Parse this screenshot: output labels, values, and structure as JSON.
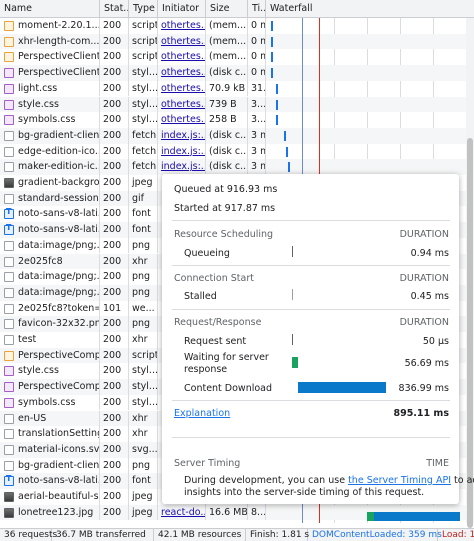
{
  "columns": [
    {
      "label": "Name"
    },
    {
      "label": "Stat..."
    },
    {
      "label": "Type"
    },
    {
      "label": "Initiator"
    },
    {
      "label": "Size"
    },
    {
      "label": "Ti..."
    },
    {
      "label": "Waterfall"
    }
  ],
  "rows": [
    {
      "name": "moment-2.20.1....",
      "status": "200",
      "type": "script",
      "initiator": "othertes...",
      "size": "(mem...",
      "time": "0 ms",
      "icon": "script"
    },
    {
      "name": "xhr-length-com...",
      "status": "200",
      "type": "script",
      "initiator": "othertes...",
      "size": "(mem...",
      "time": "0 ms",
      "icon": "script"
    },
    {
      "name": "PerspectiveClient...",
      "status": "200",
      "type": "script",
      "initiator": "othertes...",
      "size": "(mem...",
      "time": "0 ms",
      "icon": "script"
    },
    {
      "name": "PerspectiveClient...",
      "status": "200",
      "type": "styl...",
      "initiator": "othertes...",
      "size": "(disk c...",
      "time": "0 ms",
      "icon": "style"
    },
    {
      "name": "light.css",
      "status": "200",
      "type": "styl...",
      "initiator": "othertes...",
      "size": "70.9 kB",
      "time": "31...",
      "icon": "style"
    },
    {
      "name": "style.css",
      "status": "200",
      "type": "styl...",
      "initiator": "othertes...",
      "size": "739 B",
      "time": "3...",
      "icon": "style"
    },
    {
      "name": "symbols.css",
      "status": "200",
      "type": "styl...",
      "initiator": "othertes...",
      "size": "258 B",
      "time": "3...",
      "icon": "style"
    },
    {
      "name": "bg-gradient-clien...",
      "status": "200",
      "type": "fetch",
      "initiator": "index.js:...",
      "size": "(disk c...",
      "time": "3 ms",
      "icon": "fetch"
    },
    {
      "name": "edge-edition-ico...",
      "status": "200",
      "type": "fetch",
      "initiator": "index.js:...",
      "size": "(disk c...",
      "time": "3 ms",
      "icon": "fetch"
    },
    {
      "name": "maker-edition-ic...",
      "status": "200",
      "type": "fetch",
      "initiator": "index.js:...",
      "size": "(disk c...",
      "time": "3 ms",
      "icon": "fetch"
    },
    {
      "name": "gradient-backgro...",
      "status": "200",
      "type": "jpeg",
      "initiator": "",
      "size": "",
      "time": "",
      "icon": "jpeg"
    },
    {
      "name": "standard-session...",
      "status": "200",
      "type": "gif",
      "initiator": "",
      "size": "",
      "time": "",
      "icon": "gif"
    },
    {
      "name": "noto-sans-v8-lati...",
      "status": "200",
      "type": "font",
      "initiator": "",
      "size": "",
      "time": "",
      "icon": "font"
    },
    {
      "name": "noto-sans-v8-lati...",
      "status": "200",
      "type": "font",
      "initiator": "",
      "size": "",
      "time": "",
      "icon": "font"
    },
    {
      "name": "data:image/png;...",
      "status": "200",
      "type": "png",
      "initiator": "",
      "size": "",
      "time": "",
      "icon": "png"
    },
    {
      "name": "2e025fc8",
      "status": "200",
      "type": "xhr",
      "initiator": "",
      "size": "",
      "time": "",
      "icon": "xhr"
    },
    {
      "name": "data:image/png;...",
      "status": "200",
      "type": "png",
      "initiator": "",
      "size": "",
      "time": "",
      "icon": "png"
    },
    {
      "name": "data:image/png;...",
      "status": "200",
      "type": "png",
      "initiator": "",
      "size": "",
      "time": "",
      "icon": "png"
    },
    {
      "name": "2e025fc8?token=...",
      "status": "101",
      "type": "we...",
      "initiator": "",
      "size": "",
      "time": "",
      "icon": "ws"
    },
    {
      "name": "favicon-32x32.png",
      "status": "200",
      "type": "png",
      "initiator": "",
      "size": "",
      "time": "",
      "icon": "png"
    },
    {
      "name": "test",
      "status": "200",
      "type": "xhr",
      "initiator": "",
      "size": "",
      "time": "",
      "icon": "xhr"
    },
    {
      "name": "PerspectiveComp...",
      "status": "200",
      "type": "script",
      "initiator": "",
      "size": "",
      "time": "",
      "icon": "script"
    },
    {
      "name": "style.css",
      "status": "200",
      "type": "styl...",
      "initiator": "",
      "size": "",
      "time": "",
      "icon": "style"
    },
    {
      "name": "PerspectiveComp...",
      "status": "200",
      "type": "styl...",
      "initiator": "",
      "size": "",
      "time": "",
      "icon": "style"
    },
    {
      "name": "symbols.css",
      "status": "200",
      "type": "styl...",
      "initiator": "",
      "size": "",
      "time": "",
      "icon": "style"
    },
    {
      "name": "en-US",
      "status": "200",
      "type": "xhr",
      "initiator": "",
      "size": "",
      "time": "",
      "icon": "xhr"
    },
    {
      "name": "translationSettings",
      "status": "200",
      "type": "xhr",
      "initiator": "",
      "size": "",
      "time": "",
      "icon": "xhr"
    },
    {
      "name": "material-icons.svg",
      "status": "200",
      "type": "svg...",
      "initiator": "",
      "size": "",
      "time": "",
      "icon": "svg"
    },
    {
      "name": "bg-gradient-clien...",
      "status": "200",
      "type": "png",
      "initiator": "",
      "size": "",
      "time": "",
      "icon": "png"
    },
    {
      "name": "noto-sans-v8-lati...",
      "status": "200",
      "type": "font",
      "initiator": "",
      "size": "",
      "time": "",
      "icon": "font"
    },
    {
      "name": "aerial-beautiful-s...",
      "status": "200",
      "type": "jpeg",
      "initiator": "",
      "size": "",
      "time": "",
      "icon": "jpeg"
    },
    {
      "name": "lonetree123.jpg",
      "status": "200",
      "type": "jpeg",
      "initiator": "react-do...",
      "size": "16.6 MB",
      "time": "8...",
      "icon": "jpeg"
    }
  ],
  "popup": {
    "queued_at": "Queued at 916.93 ms",
    "started_at": "Started at 917.87 ms",
    "resource_scheduling": "Resource Scheduling",
    "duration": "DURATION",
    "queueing_label": "Queueing",
    "queueing_value": "0.94 ms",
    "connection_start": "Connection Start",
    "stalled_label": "Stalled",
    "stalled_value": "0.45 ms",
    "request_response": "Request/Response",
    "request_sent_label": "Request sent",
    "request_sent_value": "50 μs",
    "waiting_label_1": "Waiting for server",
    "waiting_label_2": "response",
    "waiting_value": "56.69 ms",
    "download_label": "Content Download",
    "download_value": "836.99 ms",
    "explanation": "Explanation",
    "total": "895.11 ms",
    "server_timing": "Server Timing",
    "time": "TIME",
    "note_1": "During development, you can use",
    "note_link": "the Server Timing API",
    "note_2": "to add",
    "note_3": "insights into the server-side timing of this request."
  },
  "status_bar": {
    "requests": "36 requests",
    "transferred": "36.7 MB transferred",
    "resources": "42.1 MB resources",
    "finish": "Finish: 1.81 s",
    "dcl": "DOMContentLoaded: 359 ms",
    "load": "Load: 1..."
  },
  "colors": {
    "waiting_green": "#1aa260",
    "download_blue": "#0b79c9",
    "dcl_line": "#6a8ccf",
    "load_line": "#d93025"
  }
}
